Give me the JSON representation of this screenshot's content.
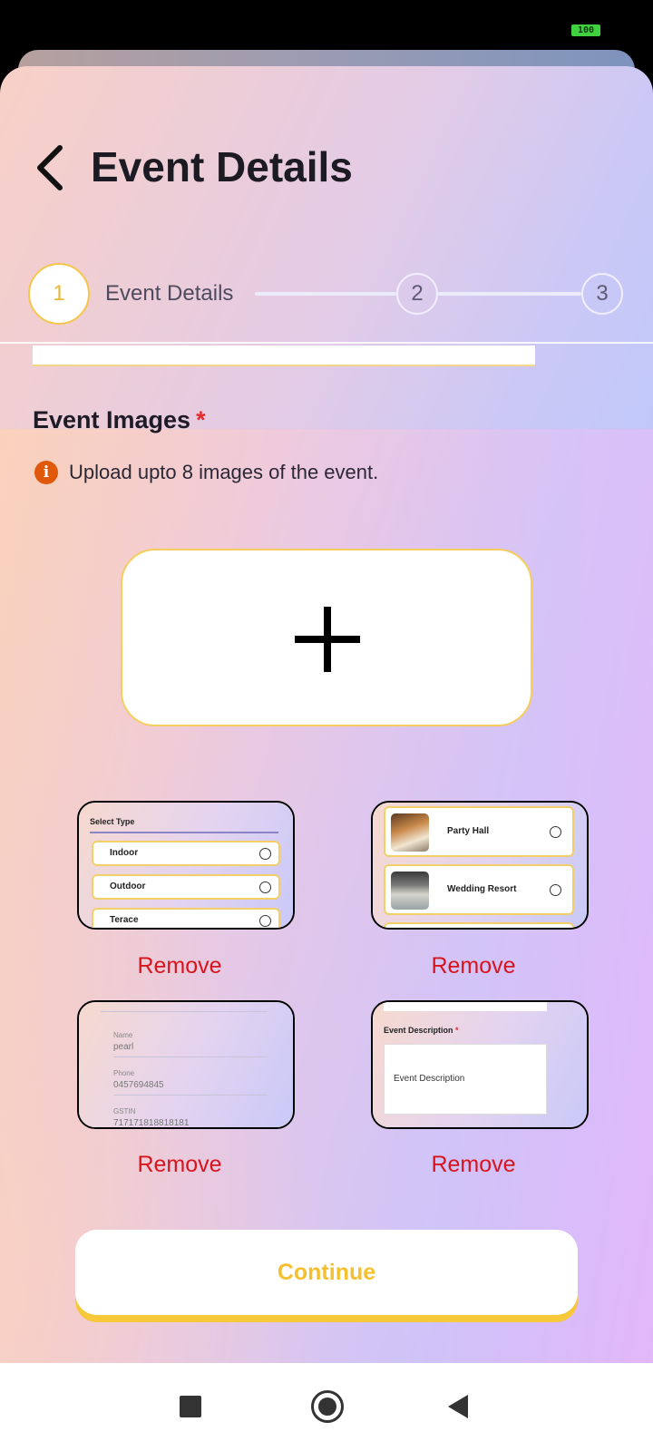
{
  "status_bar": {
    "battery": "100"
  },
  "header": {
    "title": "Event Details"
  },
  "stepper": {
    "steps": [
      {
        "number": "1",
        "label": "Event Details",
        "active": true
      },
      {
        "number": "2",
        "label": "",
        "active": false
      },
      {
        "number": "3",
        "label": "",
        "active": false
      }
    ]
  },
  "images_section": {
    "title": "Event Images",
    "required_mark": "*",
    "info_icon": "i",
    "info_text": "Upload upto 8 images of the event.",
    "add_icon": "plus-icon"
  },
  "thumbnails": [
    {
      "remove_label": "Remove",
      "content": {
        "title": "Select Type",
        "options": [
          "Indoor",
          "Outdoor",
          "Terace"
        ]
      }
    },
    {
      "remove_label": "Remove",
      "content": {
        "venues": [
          "Party Hall",
          "Wedding Resort"
        ]
      }
    },
    {
      "remove_label": "Remove",
      "content": {
        "fields": [
          {
            "label": "Name",
            "value": "pearl"
          },
          {
            "label": "Phone",
            "value": "0457694845"
          },
          {
            "label": "GSTIN",
            "value": "717171818818181"
          }
        ]
      }
    },
    {
      "remove_label": "Remove",
      "content": {
        "title": "Event Description",
        "required_mark": "*",
        "placeholder": "Event Description"
      }
    }
  ],
  "footer": {
    "continue_label": "Continue"
  },
  "colors": {
    "accent": "#F5C030",
    "danger": "#D8141C",
    "info": "#E0580A"
  }
}
